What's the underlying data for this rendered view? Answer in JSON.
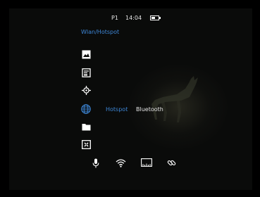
{
  "status_bar": {
    "profile": "P1",
    "time": "14:04",
    "battery_level": 0.55
  },
  "menu": {
    "title": "Wlan/Hotspot",
    "items": [
      {
        "icon": "image-icon"
      },
      {
        "icon": "settings-list-icon"
      },
      {
        "icon": "crosshair-icon"
      },
      {
        "icon": "globe-icon",
        "options": [
          "Hotspot",
          "Bluetooth"
        ],
        "selected": "Hotspot"
      },
      {
        "icon": "folder-icon"
      },
      {
        "icon": "calibrate-icon"
      }
    ]
  },
  "bottom_bar": {
    "icons": [
      "microphone-icon",
      "wifi-icon",
      "ruler-icon",
      "link-icon"
    ]
  },
  "colors": {
    "accent": "#3d86d6",
    "background": "#0a0b0a",
    "text": "#e6e6e6"
  }
}
